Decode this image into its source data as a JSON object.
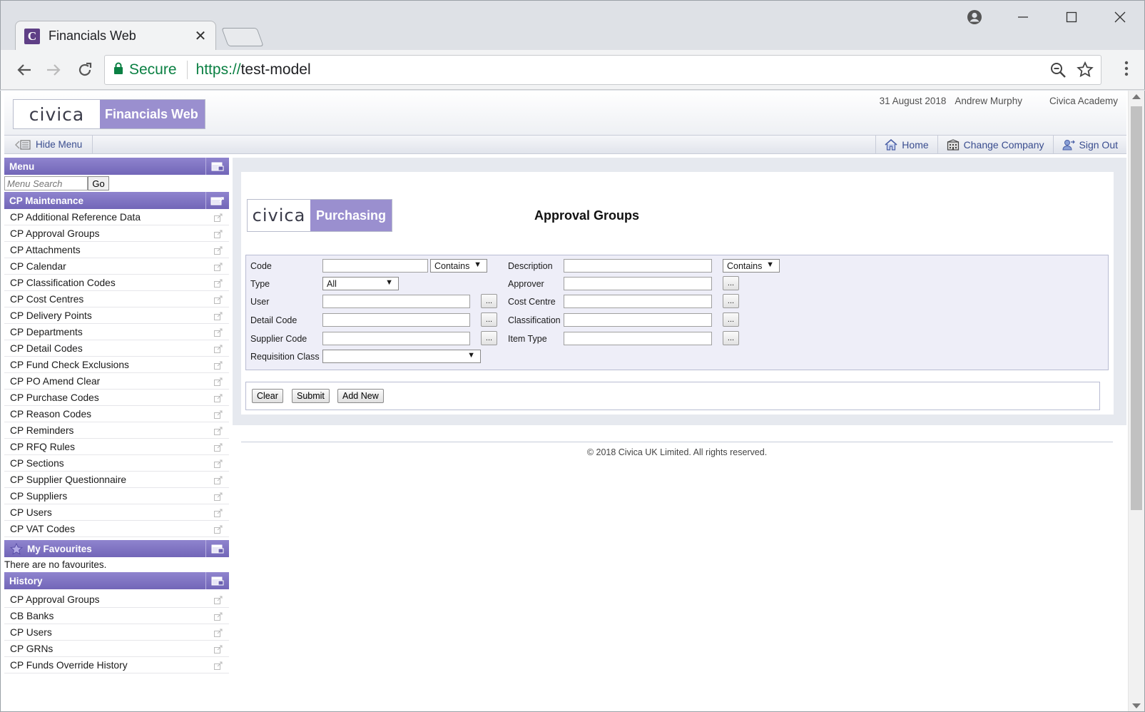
{
  "browser": {
    "tab_title": "Financials Web",
    "favicon_letter": "C",
    "tab_close": "✕",
    "secure_label": "Secure",
    "url_scheme": "https://",
    "url_host": "test-model"
  },
  "header": {
    "logo_text": "civica",
    "product_name": "Financials Web",
    "date": "31 August 2018",
    "user": "Andrew Murphy",
    "company": "Civica Academy"
  },
  "menubar": {
    "hide_menu": "Hide Menu",
    "home": "Home",
    "change_company": "Change Company",
    "sign_out": "Sign Out"
  },
  "sidebar": {
    "menu_title": "Menu",
    "search_placeholder": "Menu Search",
    "go_label": "Go",
    "section_title": "CP Maintenance",
    "items": [
      "CP Additional Reference Data",
      "CP Approval Groups",
      "CP Attachments",
      "CP Calendar",
      "CP Classification Codes",
      "CP Cost Centres",
      "CP Delivery Points",
      "CP Departments",
      "CP Detail Codes",
      "CP Fund Check Exclusions",
      "CP PO Amend Clear",
      "CP Purchase Codes",
      "CP Reason Codes",
      "CP Reminders",
      "CP RFQ Rules",
      "CP Sections",
      "CP Supplier Questionnaire",
      "CP Suppliers",
      "CP Users",
      "CP VAT Codes"
    ],
    "favourites_title": "My Favourites",
    "favourites_empty": "There are no favourites.",
    "history_title": "History",
    "history_items": [
      "CP Approval Groups",
      "CB Banks",
      "CP Users",
      "CP GRNs",
      "CP Funds Override History"
    ]
  },
  "main": {
    "logo_text": "civica",
    "product_name": "Purchasing",
    "title": "Approval Groups",
    "filters": {
      "code_label": "Code",
      "code_match": "Contains",
      "description_label": "Description",
      "description_match": "Contains",
      "type_label": "Type",
      "type_value": "All",
      "approver_label": "Approver",
      "user_label": "User",
      "cost_centre_label": "Cost Centre",
      "detail_code_label": "Detail Code",
      "classification_label": "Classification",
      "supplier_code_label": "Supplier Code",
      "item_type_label": "Item Type",
      "requisition_class_label": "Requisition Class",
      "lookup_label": "..."
    },
    "buttons": {
      "clear": "Clear",
      "submit": "Submit",
      "add_new": "Add New"
    },
    "footer": "© 2018 Civica UK Limited. All rights reserved."
  },
  "colors": {
    "brand_purple": "#9a8fcf",
    "menu_header": "#7266b8",
    "link_blue": "#3a4d8f"
  }
}
